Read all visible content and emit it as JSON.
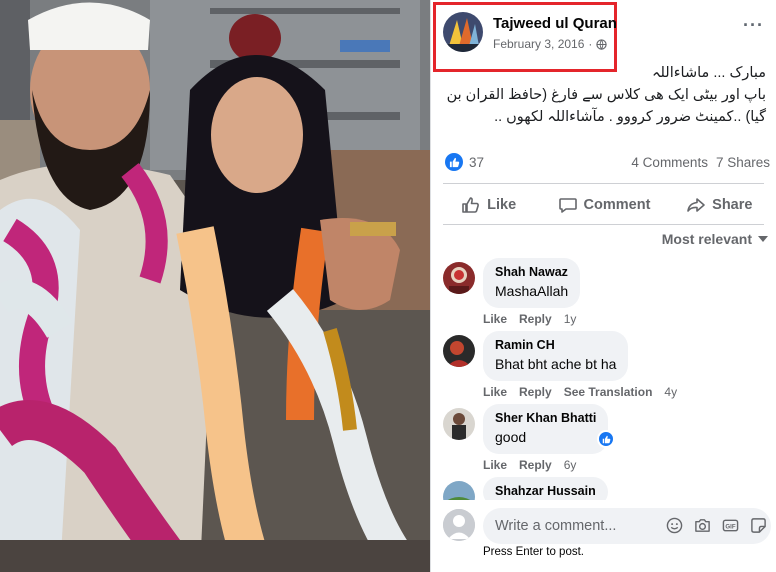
{
  "post": {
    "page_name": "Tajweed ul Quran",
    "date": "February 3, 2016",
    "separator": "·",
    "more": "···",
    "text_lines": [
      "مبارک ... ماشاءاللہ",
      "باپ اور بیٹی ایک ھی کلاس سے فارغ (حافظ القران بن",
      "گیا) ..کمینٹ ضرور کرووو . مآشاءاللہ لکھوں .."
    ],
    "reaction_count": "37",
    "comments_count": "4 Comments",
    "shares_count": "7 Shares"
  },
  "actions": {
    "like": "Like",
    "comment": "Comment",
    "share": "Share"
  },
  "sort_label": "Most relevant",
  "comments": [
    {
      "name": "Shah Nawaz",
      "text": "MashaAllah",
      "like": "Like",
      "reply": "Reply",
      "translation": "",
      "time": "1y"
    },
    {
      "name": "Ramin CH",
      "text": "Bhat bht ache bt ha",
      "like": "Like",
      "reply": "Reply",
      "translation": "See Translation",
      "time": "4y"
    },
    {
      "name": "Sher Khan Bhatti",
      "text": "good",
      "like": "Like",
      "reply": "Reply",
      "translation": "",
      "time": "6y"
    },
    {
      "name": "Shahzar Hussain",
      "text": "",
      "like": "",
      "reply": "",
      "translation": "",
      "time": ""
    }
  ],
  "composer": {
    "placeholder": "Write a comment...",
    "hint": "Press Enter to post."
  },
  "icons": {
    "like": "thumbs-up-icon",
    "comment": "speech-bubble-icon",
    "share": "share-arrow-icon",
    "globe": "globe-icon",
    "emoji": "smiley-icon",
    "camera": "camera-icon",
    "gif": "gif-icon",
    "sticker": "sticker-icon"
  },
  "colors": {
    "accent": "#1877f2",
    "highlight_box": "#e4252b",
    "muted_text": "#65676b",
    "bubble": "#f0f2f5"
  }
}
